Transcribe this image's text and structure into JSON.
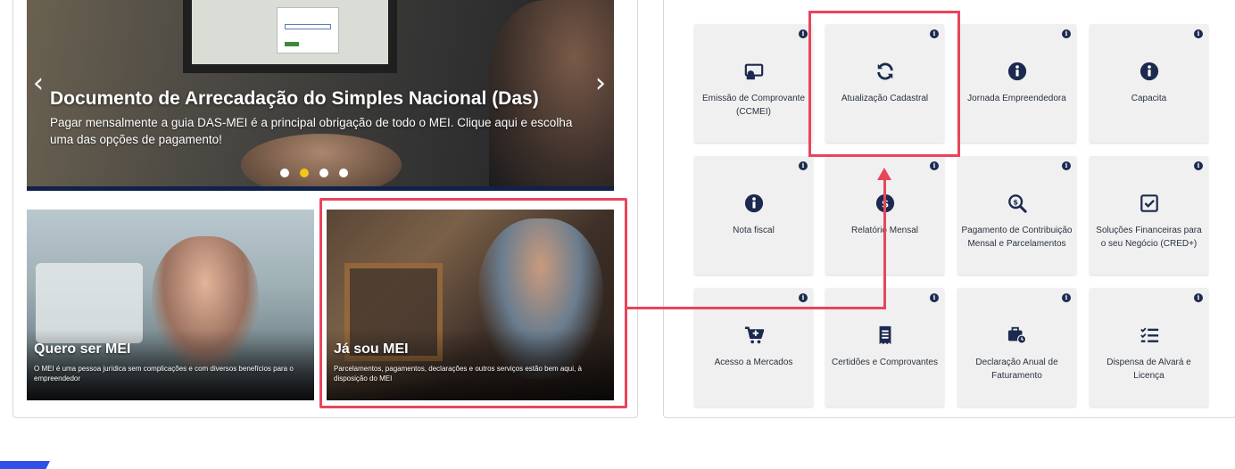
{
  "carousel": {
    "title": "Documento de Arrecadação do Simples Nacional (Das)",
    "description": "Pagar mensalmente a guia DAS-MEI é a principal obrigação de todo o MEI. Clique aqui e escolha uma das opções de pagamento!",
    "prev_icon": "chevron-left-icon",
    "next_icon": "chevron-right-icon",
    "dots": 4,
    "active_dot": 2,
    "dot_active_color": "#f5c518"
  },
  "cards": [
    {
      "title": "Quero ser MEI",
      "description": "O MEI é uma pessoa jurídica sem complicações e com diversos benefícios para o empreendedor"
    },
    {
      "title": "Já sou MEI",
      "description": "Parcelamentos, pagamentos, declarações e outros serviços estão bem aqui, à disposição do MEI"
    }
  ],
  "tiles": [
    {
      "label": "Emissão de Comprovante (CCMEI)",
      "icon": "certificate-icon"
    },
    {
      "label": "Atualização Cadastral",
      "icon": "refresh-icon"
    },
    {
      "label": "Jornada Empreendedora",
      "icon": "info-circle-icon"
    },
    {
      "label": "Capacita",
      "icon": "info-circle-icon"
    },
    {
      "label": "Nota fiscal",
      "icon": "info-circle-icon"
    },
    {
      "label": "Relatório Mensal",
      "icon": "report-icon"
    },
    {
      "label": "Pagamento de Contribuição Mensal e Parcelamentos",
      "icon": "search-dollar-icon"
    },
    {
      "label": "Soluções Financeiras para o seu Negócio (CRED+)",
      "icon": "checkbox-icon"
    },
    {
      "label": "Acesso a Mercados",
      "icon": "cart-plus-icon"
    },
    {
      "label": "Certidões e Comprovantes",
      "icon": "receipt-icon"
    },
    {
      "label": "Declaração Anual de Faturamento",
      "icon": "briefcase-clock-icon"
    },
    {
      "label": "Dispensa de Alvará e Licença",
      "icon": "checklist-icon"
    }
  ],
  "tile_info_glyph": "i",
  "colors": {
    "highlight": "#e8455b",
    "icon": "#1b2a4e",
    "tile_bg": "#f0f0f0",
    "carousel_bar": "#10224a",
    "brand": "#3050e8"
  }
}
